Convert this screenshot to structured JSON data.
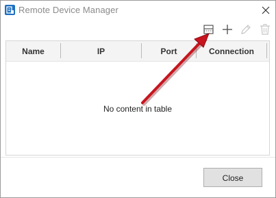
{
  "window": {
    "title": "Remote Device Manager",
    "accent_color": "#1e6fbf"
  },
  "toolbar": {
    "items": [
      {
        "icon": "scan-device-icon",
        "enabled": true
      },
      {
        "icon": "add-icon",
        "enabled": true
      },
      {
        "icon": "edit-pencil-icon",
        "enabled": false
      },
      {
        "icon": "delete-trash-icon",
        "enabled": false
      }
    ]
  },
  "table": {
    "columns": [
      "Name",
      "IP",
      "Port",
      "Connection"
    ],
    "rows": [],
    "empty_message": "No content in table"
  },
  "footer": {
    "close_label": "Close"
  },
  "annotation": {
    "arrow_color": "#c8141e"
  }
}
